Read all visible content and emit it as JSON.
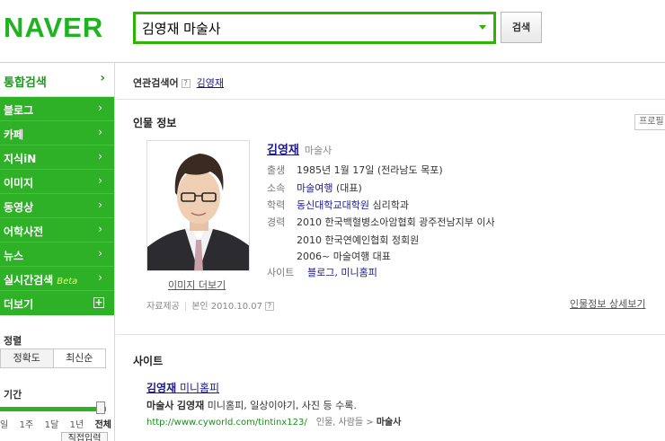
{
  "header": {
    "logo": "NAVER",
    "query": "김영재 마술사",
    "search_button": "검색"
  },
  "sidebar": {
    "top": "통합검색",
    "items": [
      {
        "label": "블로그"
      },
      {
        "label": "카페"
      },
      {
        "label": "지식iN"
      },
      {
        "label": "이미지"
      },
      {
        "label": "동영상"
      },
      {
        "label": "어학사전"
      },
      {
        "label": "뉴스"
      },
      {
        "label": "실시간검색",
        "badge": "Beta"
      }
    ],
    "more": "더보기",
    "sort_title": "정렬",
    "sort_options": [
      "정확도",
      "최신순"
    ],
    "period_title": "기간",
    "period_options": [
      "일",
      "1주",
      "1달",
      "1년",
      "전체"
    ],
    "direct_input": "직접입력"
  },
  "related": {
    "label": "연관검색어",
    "term": "김영재"
  },
  "person": {
    "section_title": "인물 정보",
    "profile_tag": "프로필",
    "name": "김영재",
    "job": "마술사",
    "photo_link": "이미지 더보기",
    "rows": [
      {
        "key": "출생",
        "value": "1985년 1월 17일 (전라남도 목포)"
      },
      {
        "key": "소속",
        "link": "마술여행",
        "value": " (대표)"
      },
      {
        "key": "학력",
        "link": "동신대학교대학원",
        "value": " 심리학과"
      },
      {
        "key": "경력",
        "lines": [
          "2010 한국백혈병소아암협회 광주전남지부 이사",
          "2010 한국연예인협회 정회원",
          "2006~ 마술여행 대표"
        ]
      },
      {
        "key": "사이트",
        "link": "블로그, 미니홈피"
      }
    ],
    "source_label": "자료제공",
    "source_value": "본인 2010.10.07",
    "detail_link": "인물정보 상세보기"
  },
  "site": {
    "section_title": "사이트",
    "link_bold": "김영재",
    "link_rest": " 미니홈피",
    "desc_bold1": "마술사",
    "desc_bold2": "김영재",
    "desc_rest": " 미니홈피, 일상이야기, 사진 등 수록.",
    "url": "http://www.cyworld.com/tintinx123/",
    "crumb": "인물, 사람들 > ",
    "crumb_bold": "마술사"
  }
}
